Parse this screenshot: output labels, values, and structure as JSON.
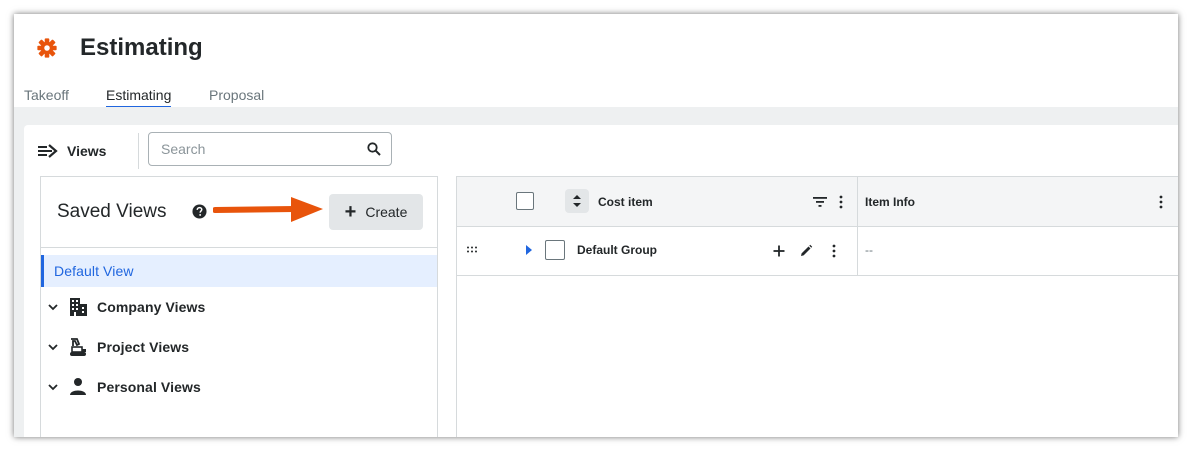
{
  "app": {
    "title": "Estimating",
    "accent_color": "#e8540b",
    "icon": "gear-icon"
  },
  "tabs": [
    {
      "label": "Takeoff",
      "active": false
    },
    {
      "label": "Estimating",
      "active": true
    },
    {
      "label": "Proposal",
      "active": false
    }
  ],
  "toolbar": {
    "views_label": "Views",
    "views_icon": "arrow-right-lines-icon",
    "search_placeholder": "Search",
    "search_value": ""
  },
  "saved_views": {
    "title": "Saved Views",
    "help_icon": "help-circle-icon",
    "create_label": "Create",
    "create_icon": "plus-icon",
    "annotation_arrow_color": "#e8540b",
    "items": [
      {
        "label": "Default View",
        "selected": true
      },
      {
        "label": "Company Views",
        "icon": "building-icon",
        "expandable": true
      },
      {
        "label": "Project Views",
        "icon": "crane-icon",
        "expandable": true
      },
      {
        "label": "Personal Views",
        "icon": "person-icon",
        "expandable": true
      }
    ]
  },
  "grid": {
    "columns": [
      {
        "label": "Cost item"
      },
      {
        "label": "Item Info"
      }
    ],
    "rows": [
      {
        "name": "Default Group",
        "item_info": "--"
      }
    ]
  }
}
